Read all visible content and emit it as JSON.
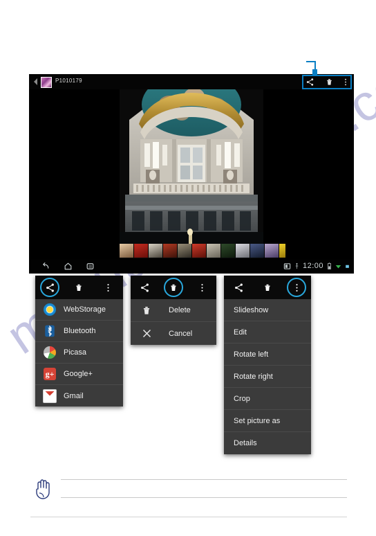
{
  "page": {
    "watermark": "manualsmachine.com",
    "background_color": "#ffffff"
  },
  "tablet": {
    "title": "P1010179",
    "back_icon": "back-chevron-icon",
    "thumbnail_icon": "photo-thumbnail-icon",
    "actionbar_icons": [
      "share-icon",
      "delete-icon",
      "overflow-menu-icon"
    ],
    "navbar": {
      "left_icons": [
        "back-icon",
        "home-icon",
        "recent-apps-icon"
      ],
      "clock": "12:00",
      "right_icons": [
        "screenshot-icon",
        "usb-icon",
        "battery-icon",
        "wifi-icon",
        "signal-icon"
      ]
    },
    "photo_alt": "Ornate cathedral dome interior"
  },
  "callout": {
    "accent_color": "#0a7fc4",
    "target": "actionbar-icons"
  },
  "panels": [
    {
      "id": "share",
      "highlight_index": 0,
      "highlight_color": "#29a8dd",
      "bar_icons": [
        "share-icon",
        "delete-icon",
        "overflow-menu-icon"
      ],
      "items": [
        {
          "label": "WebStorage",
          "icon": "webstorage-icon"
        },
        {
          "label": "Bluetooth",
          "icon": "bluetooth-icon"
        },
        {
          "label": "Picasa",
          "icon": "picasa-icon"
        },
        {
          "label": "Google+",
          "icon": "googleplus-icon"
        },
        {
          "label": "Gmail",
          "icon": "gmail-icon"
        }
      ]
    },
    {
      "id": "delete",
      "highlight_index": 1,
      "highlight_color": "#29a8dd",
      "bar_icons": [
        "share-icon",
        "delete-icon",
        "overflow-menu-icon"
      ],
      "items": [
        {
          "label": "Delete",
          "icon": "trash-icon"
        },
        {
          "label": "Cancel",
          "icon": "close-x-icon"
        }
      ]
    },
    {
      "id": "overflow",
      "highlight_index": 2,
      "highlight_color": "#29a8dd",
      "bar_icons": [
        "share-icon",
        "delete-icon",
        "overflow-menu-icon"
      ],
      "items": [
        {
          "label": "Slideshow",
          "icon": ""
        },
        {
          "label": "Edit",
          "icon": ""
        },
        {
          "label": "Rotate left",
          "icon": ""
        },
        {
          "label": "Rotate right",
          "icon": ""
        },
        {
          "label": "Crop",
          "icon": ""
        },
        {
          "label": "Set picture as",
          "icon": ""
        },
        {
          "label": "Details",
          "icon": ""
        }
      ]
    }
  ],
  "note": {
    "icon": "hand-note-icon",
    "lines": [
      "",
      ""
    ]
  }
}
